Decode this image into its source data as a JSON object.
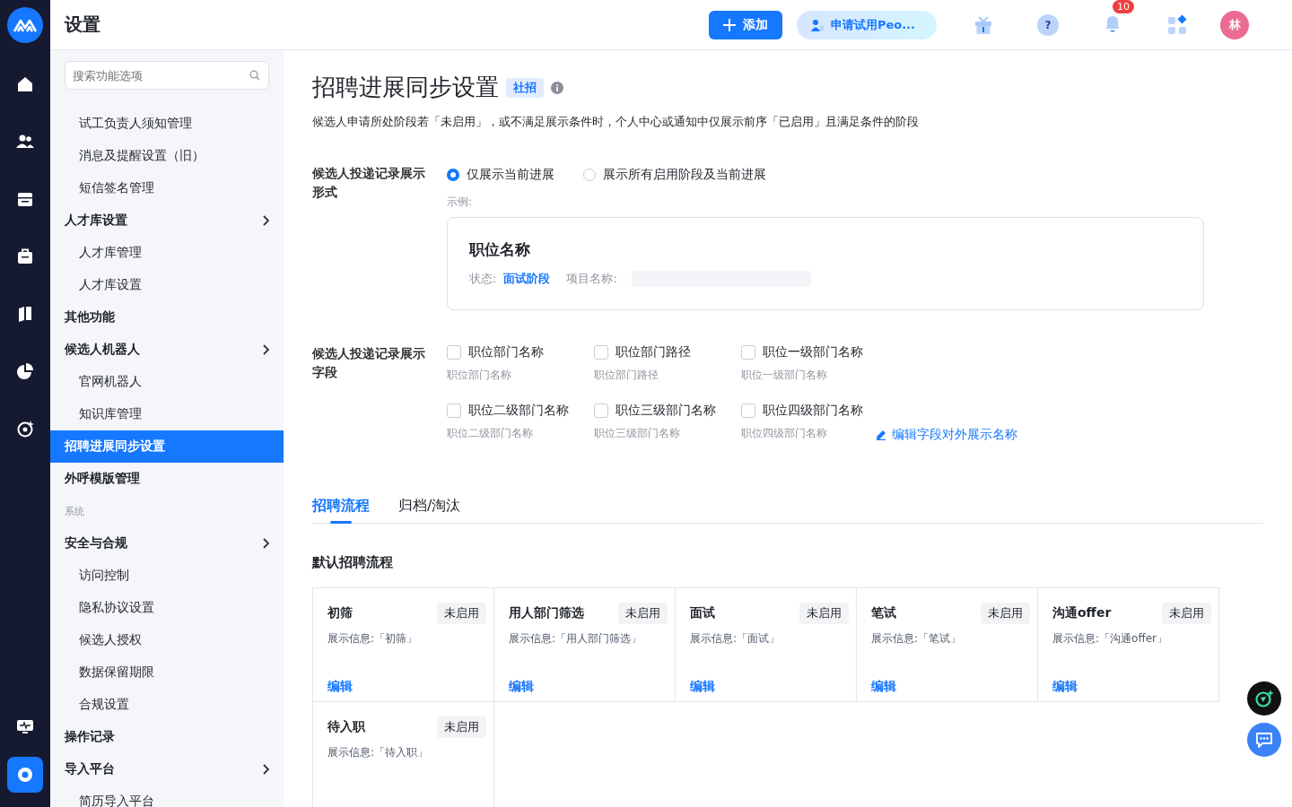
{
  "header": {
    "title": "设置",
    "add_button": "添加",
    "trial_button": "申请试用Peo...",
    "help": "?",
    "notification_count": "10",
    "avatar": "林"
  },
  "sidebar": {
    "search": {
      "placeholder": "搜索功能选项"
    },
    "items": [
      {
        "label": "试工负责人须知管理",
        "kind": "sub",
        "chevron": false,
        "selected": false
      },
      {
        "label": "消息及提醒设置（旧）",
        "kind": "sub",
        "chevron": false,
        "selected": false
      },
      {
        "label": "短信签名管理",
        "kind": "sub",
        "chevron": false,
        "selected": false
      },
      {
        "label": "人才库设置",
        "kind": "group",
        "chevron": true,
        "selected": false
      },
      {
        "label": "人才库管理",
        "kind": "sub",
        "chevron": false,
        "selected": false
      },
      {
        "label": "人才库设置",
        "kind": "sub",
        "chevron": false,
        "selected": false
      },
      {
        "label": "其他功能",
        "kind": "group",
        "chevron": false,
        "selected": false
      },
      {
        "label": "候选人机器人",
        "kind": "group",
        "chevron": true,
        "selected": false
      },
      {
        "label": "官网机器人",
        "kind": "sub",
        "chevron": false,
        "selected": false
      },
      {
        "label": "知识库管理",
        "kind": "sub",
        "chevron": false,
        "selected": false
      },
      {
        "label": "招聘进展同步设置",
        "kind": "group",
        "chevron": false,
        "selected": true
      },
      {
        "label": "外呼模版管理",
        "kind": "group",
        "chevron": false,
        "selected": false
      },
      {
        "label": "系统",
        "kind": "section",
        "chevron": false,
        "selected": false
      },
      {
        "label": "安全与合规",
        "kind": "group",
        "chevron": true,
        "selected": false
      },
      {
        "label": "访问控制",
        "kind": "sub",
        "chevron": false,
        "selected": false
      },
      {
        "label": "隐私协议设置",
        "kind": "sub",
        "chevron": false,
        "selected": false
      },
      {
        "label": "候选人授权",
        "kind": "sub",
        "chevron": false,
        "selected": false
      },
      {
        "label": "数据保留期限",
        "kind": "sub",
        "chevron": false,
        "selected": false
      },
      {
        "label": "合规设置",
        "kind": "sub",
        "chevron": false,
        "selected": false
      },
      {
        "label": "操作记录",
        "kind": "group",
        "chevron": false,
        "selected": false
      },
      {
        "label": "导入平台",
        "kind": "group",
        "chevron": true,
        "selected": false
      },
      {
        "label": "简历导入平台",
        "kind": "sub",
        "chevron": false,
        "selected": false
      }
    ]
  },
  "page": {
    "title": "招聘进展同步设置",
    "tag": "社招",
    "description": "候选人申请所处阶段若「未启用」，或不满足展示条件时，个人中心或通知中仅展示前序「已启用」且满足条件的阶段",
    "display_form": {
      "label": "候选人投递记录展示形式",
      "options": [
        {
          "label": "仅展示当前进展",
          "selected": true
        },
        {
          "label": "展示所有启用阶段及当前进展",
          "selected": false
        }
      ],
      "example_label": "示例:",
      "example": {
        "title": "职位名称",
        "status_label": "状态:",
        "status": "面试阶段",
        "project_label": "项目名称:"
      }
    },
    "display_fields": {
      "label": "候选人投递记录展示字段",
      "fields": [
        {
          "label": "职位部门名称",
          "hint": "职位部门名称",
          "checked": false
        },
        {
          "label": "职位部门路径",
          "hint": "职位部门路径",
          "checked": false
        },
        {
          "label": "职位一级部门名称",
          "hint": "职位一级部门名称",
          "checked": false
        },
        {
          "label": "职位二级部门名称",
          "hint": "职位二级部门名称",
          "checked": false
        },
        {
          "label": "职位三级部门名称",
          "hint": "职位三级部门名称",
          "checked": false
        },
        {
          "label": "职位四级部门名称",
          "hint": "职位四级部门名称",
          "checked": false
        }
      ],
      "edit_link": "编辑字段对外展示名称"
    },
    "tabs": [
      {
        "label": "招聘流程",
        "selected": true
      },
      {
        "label": "归档/淘汰",
        "selected": false
      }
    ],
    "section_title": "默认招聘流程",
    "stages": [
      {
        "name": "初筛",
        "status": "未启用",
        "info": "展示信息:「初筛」",
        "edit": "编辑"
      },
      {
        "name": "用人部门筛选",
        "status": "未启用",
        "info": "展示信息:「用人部门筛选」",
        "edit": "编辑"
      },
      {
        "name": "面试",
        "status": "未启用",
        "info": "展示信息:「面试」",
        "edit": "编辑"
      },
      {
        "name": "笔试",
        "status": "未启用",
        "info": "展示信息:「笔试」",
        "edit": "编辑"
      },
      {
        "name": "沟通offer",
        "status": "未启用",
        "info": "展示信息:「沟通offer」",
        "edit": "编辑"
      },
      {
        "name": "待入职",
        "status": "未启用",
        "info": "展示信息:「待入职」"
      }
    ]
  }
}
